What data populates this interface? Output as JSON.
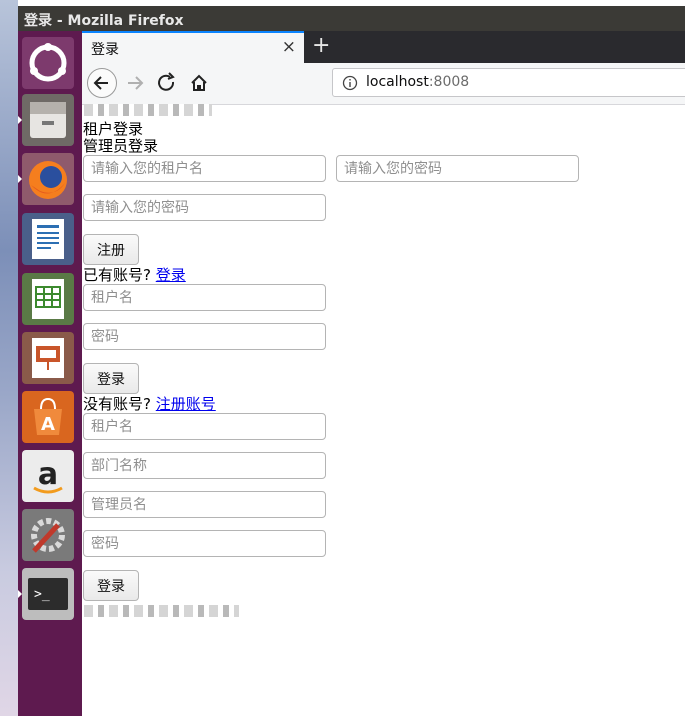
{
  "window": {
    "title": "登录 - Mozilla Firefox"
  },
  "browser": {
    "tab_title": "登录",
    "tab_close": "×",
    "new_tab": "+",
    "url_host": "localhost",
    "url_port": ":8008"
  },
  "launcher": {
    "items": [
      "ubuntu-dash-icon",
      "files-icon",
      "firefox-icon",
      "writer-icon",
      "calc-icon",
      "impress-icon",
      "software-center-icon",
      "amazon-icon",
      "system-settings-icon",
      "terminal-icon"
    ]
  },
  "page": {
    "tenant_login_label": "租户登录",
    "admin_login_label": "管理员登录",
    "register_form": {
      "tenant_name_placeholder": "请输入您的租户名",
      "password_placeholder": "请输入您的密码",
      "confirm_password_placeholder": "请输入您的密码",
      "submit_label": "注册",
      "switch_prompt": "已有账号?",
      "switch_link": "登录"
    },
    "tenant_login_form": {
      "tenant_name_placeholder": "租户名",
      "password_placeholder": "密码",
      "submit_label": "登录",
      "switch_prompt": "没有账号?",
      "switch_link": "注册账号"
    },
    "admin_login_form": {
      "tenant_name_placeholder": "租户名",
      "department_placeholder": "部门名称",
      "admin_name_placeholder": "管理员名",
      "password_placeholder": "密码",
      "submit_label": "登录"
    }
  }
}
